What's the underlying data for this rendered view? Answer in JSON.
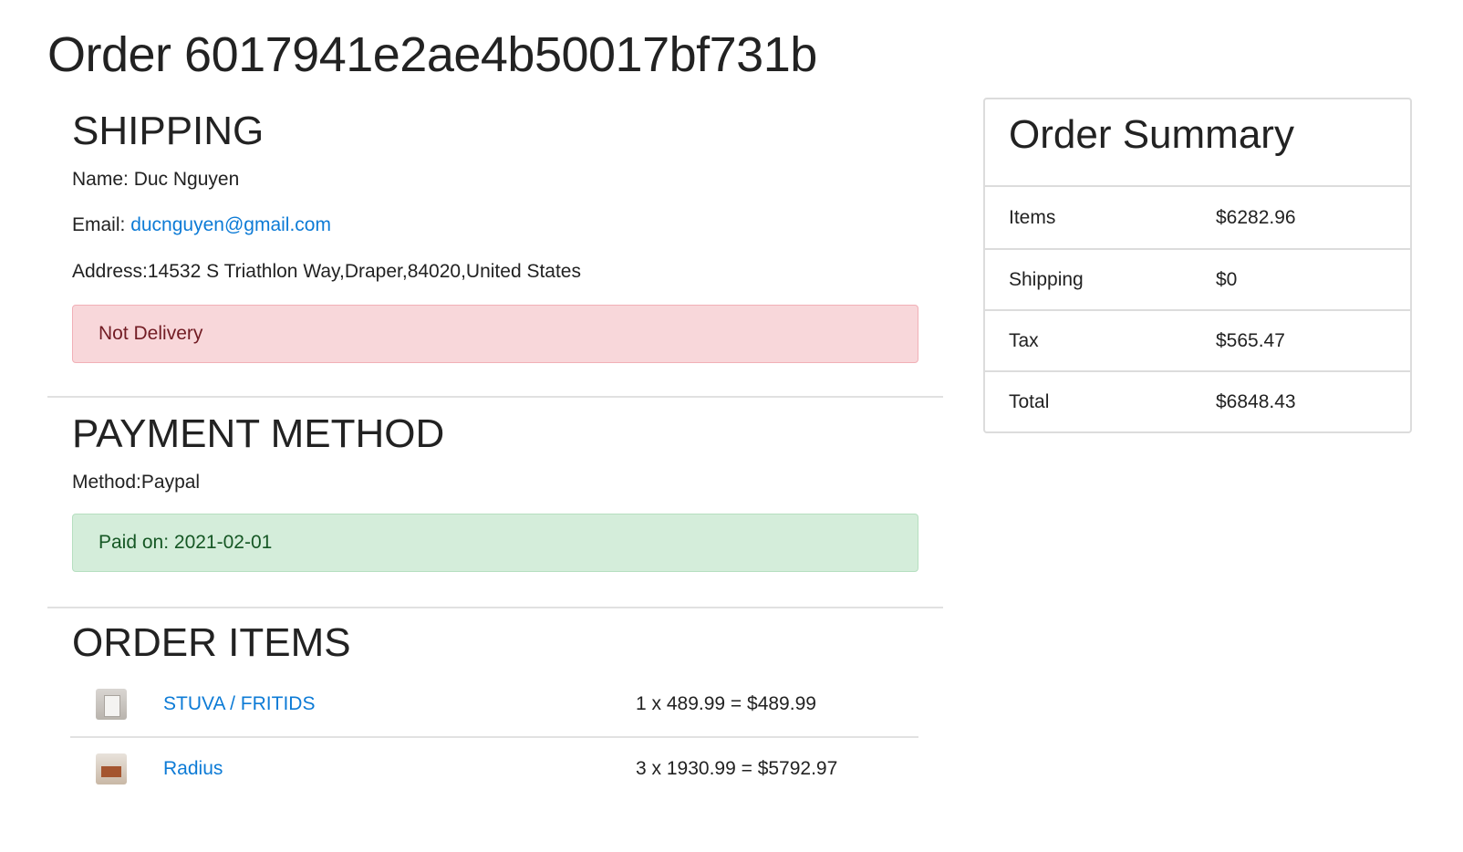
{
  "page": {
    "title": "Order 6017941e2ae4b50017bf731b"
  },
  "shipping": {
    "heading": "SHIPPING",
    "name_label": "Name:",
    "name_value": "Duc Nguyen",
    "email_label": "Email:",
    "email_value": "ducnguyen@gmail.com",
    "address_label": "Address:",
    "address_value": "14532 S Triathlon Way,Draper,84020,United States",
    "status": "Not Delivery",
    "status_color": "#f8d7da"
  },
  "payment": {
    "heading": "PAYMENT METHOD",
    "method_label": "Method:",
    "method_value": "Paypal",
    "status": "Paid on: 2021-02-01",
    "status_color": "#d4edda"
  },
  "order_items": {
    "heading": "ORDER ITEMS",
    "items": [
      {
        "name": "STUVA / FRITIDS",
        "price_line": "1 x 489.99 = $489.99",
        "thumb_icon": "crib-product-image"
      },
      {
        "name": "Radius",
        "price_line": "3 x 1930.99 = $5792.97",
        "thumb_icon": "room-product-image"
      }
    ]
  },
  "summary": {
    "title": "Order Summary",
    "rows": [
      {
        "label": "Items",
        "value": "$6282.96"
      },
      {
        "label": "Shipping",
        "value": "$0"
      },
      {
        "label": "Tax",
        "value": "$565.47"
      },
      {
        "label": "Total",
        "value": "$6848.43"
      }
    ]
  },
  "colors": {
    "link": "#0d7bd6",
    "danger_text": "#721c24",
    "success_text": "#155724"
  }
}
